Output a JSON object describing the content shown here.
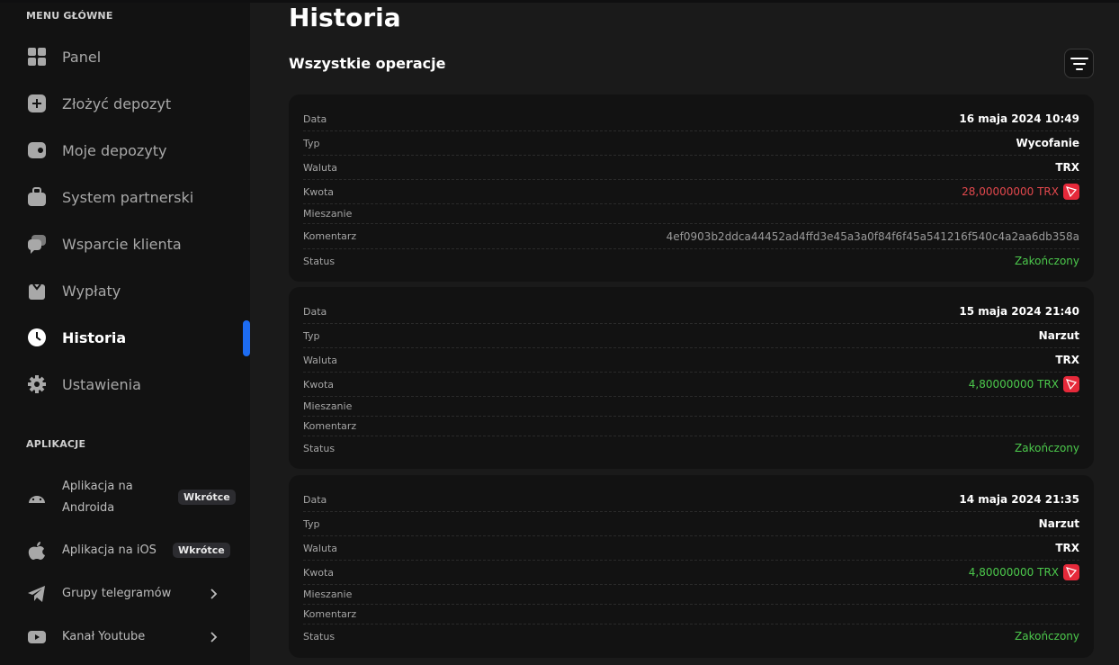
{
  "sidebar": {
    "menu_title": "MENU GŁÓWNE",
    "items": [
      {
        "label": "Panel",
        "icon": "dashboard-icon"
      },
      {
        "label": "Złożyć depozyt",
        "icon": "plus-square-icon"
      },
      {
        "label": "Moje depozyty",
        "icon": "wallet-icon"
      },
      {
        "label": "System partnerski",
        "icon": "briefcase-icon"
      },
      {
        "label": "Wsparcie klienta",
        "icon": "chat-icon"
      },
      {
        "label": "Wypłaty",
        "icon": "gift-icon"
      },
      {
        "label": "Historia",
        "icon": "clock-icon",
        "active": true
      },
      {
        "label": "Ustawienia",
        "icon": "gear-icon"
      }
    ],
    "apps_title": "APLIKACJE",
    "apps": [
      {
        "label_line1": "Aplikacja na",
        "label_line2": "Androida",
        "badge": "Wkrótce",
        "icon": "android-icon"
      },
      {
        "label": "Aplikacja na iOS",
        "badge": "Wkrótce",
        "icon": "apple-icon"
      },
      {
        "label": "Grupy telegramów",
        "icon": "telegram-icon"
      },
      {
        "label": "Kanał Youtube",
        "icon": "youtube-icon"
      }
    ]
  },
  "main": {
    "title": "Historia",
    "subtitle": "Wszystkie operacje",
    "filter_icon": "filter-icon",
    "operations": [
      {
        "date_label": "Data",
        "date": "16 maja 2024 10:49",
        "type_label": "Typ",
        "type": "Wycofanie",
        "currency_label": "Waluta",
        "currency": "TRX",
        "amount_label": "Kwota",
        "amount": "28,00000000 TRX",
        "mixing_label": "Mieszanie",
        "mixing": "",
        "comment_label": "Komentarz",
        "comment": "4ef0903b2ddca44452ad4ffd3e45a3a0f84f6f45a541216f540c4a2aa6db358a",
        "status_label": "Status",
        "status": "Zakończony"
      },
      {
        "date_label": "Data",
        "date": "15 maja 2024 21:40",
        "type_label": "Typ",
        "type": "Narzut",
        "currency_label": "Waluta",
        "currency": "TRX",
        "amount_label": "Kwota",
        "amount": "4,80000000 TRX",
        "mixing_label": "Mieszanie",
        "mixing": "",
        "comment_label": "Komentarz",
        "comment": "",
        "status_label": "Status",
        "status": "Zakończony"
      },
      {
        "date_label": "Data",
        "date": "14 maja 2024 21:35",
        "type_label": "Typ",
        "type": "Narzut",
        "currency_label": "Waluta",
        "currency": "TRX",
        "amount_label": "Kwota",
        "amount": "4,80000000 TRX",
        "mixing_label": "Mieszanie",
        "mixing": "",
        "comment_label": "Komentarz",
        "comment": "",
        "status_label": "Status",
        "status": "Zakończony"
      }
    ]
  },
  "colors": {
    "accent": "#1d6cf2",
    "negative": "#e2484d",
    "positive": "#4cc94c",
    "trx_badge": "#e6293a"
  }
}
